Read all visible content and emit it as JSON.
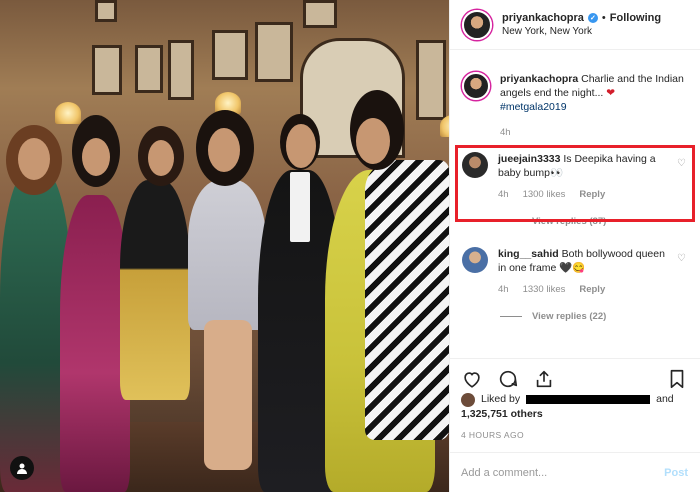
{
  "post": {
    "author": "priyankachopra",
    "separator": "•",
    "follow_status": "Following",
    "location": "New York, New York"
  },
  "caption": {
    "username": "priyankachopra",
    "text": " Charlie and the Indian angels end the night... ",
    "emoji": "❤",
    "hashtag": "#metgala2019",
    "time": "4h"
  },
  "comments": [
    {
      "username": "jueejain3333",
      "text": " Is Deepika having a baby bump",
      "emoji": "👀",
      "time": "4h",
      "likes": "1300 likes",
      "reply_label": "Reply",
      "view_replies": "View replies (87)",
      "avatar_color": "#2a2a2a"
    },
    {
      "username": "king__sahid",
      "text": " Both bollywood queen in one frame ",
      "emoji": "🖤😋",
      "time": "4h",
      "likes": "1330 likes",
      "reply_label": "Reply",
      "view_replies": "View replies (22)",
      "avatar_color": "#4a6fa5"
    }
  ],
  "likes": {
    "prefix": "Liked by ",
    "suffix": " and",
    "count_text": "1,325,751 others"
  },
  "timestamp": "4 HOURS AGO",
  "comment_box": {
    "placeholder": "Add a comment...",
    "post_label": "Post"
  },
  "icons": [
    "heart-icon",
    "comment-icon",
    "share-icon",
    "bookmark-icon",
    "verified-icon",
    "profile-icon"
  ],
  "colors": {
    "highlight": "#e8202a",
    "link": "#003569",
    "muted": "#8e8e8e",
    "post_disabled": "#b2dffc"
  }
}
